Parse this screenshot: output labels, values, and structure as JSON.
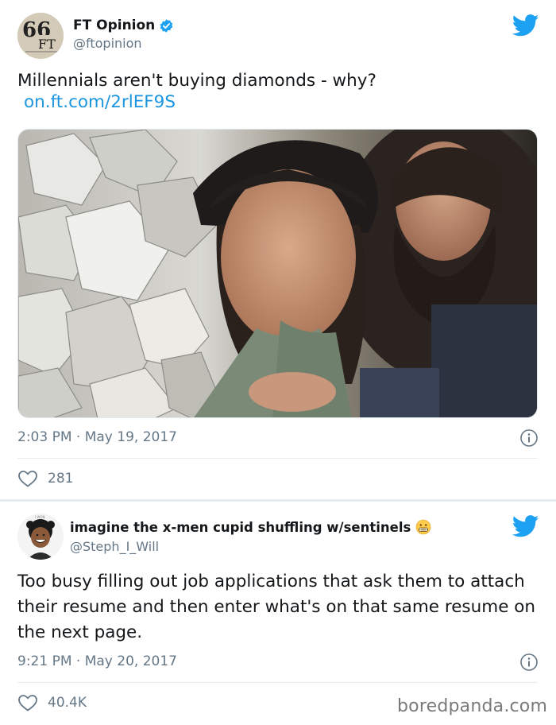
{
  "tweets": [
    {
      "display_name": "FT Opinion",
      "handle": "@ftopinion",
      "text": "Millennials aren't buying diamonds - why?",
      "link": "on.ft.com/2rlEF9S",
      "timestamp": "2:03 PM · May 19, 2017",
      "likes": "281",
      "avatar_text": "FT",
      "verified": true
    },
    {
      "display_name": "imagine the x-men cupid shuffling w/sentinels",
      "handle": "@Steph_I_Will",
      "text": "Too busy filling out job applications that ask them to attach their resume and then enter what's on that same resume on the next page.",
      "timestamp": "9:21 PM · May 20, 2017",
      "likes": "40.4K",
      "emoji": "grimacing-face-emoji"
    }
  ],
  "watermark": "boredpanda.com",
  "colors": {
    "twitter_blue": "#1da1f2",
    "link": "#1b95e0",
    "secondary_text": "#657786",
    "divider": "#e6ecf0"
  },
  "icons": [
    "verified-badge-icon",
    "twitter-bird-icon",
    "info-icon",
    "heart-icon"
  ]
}
